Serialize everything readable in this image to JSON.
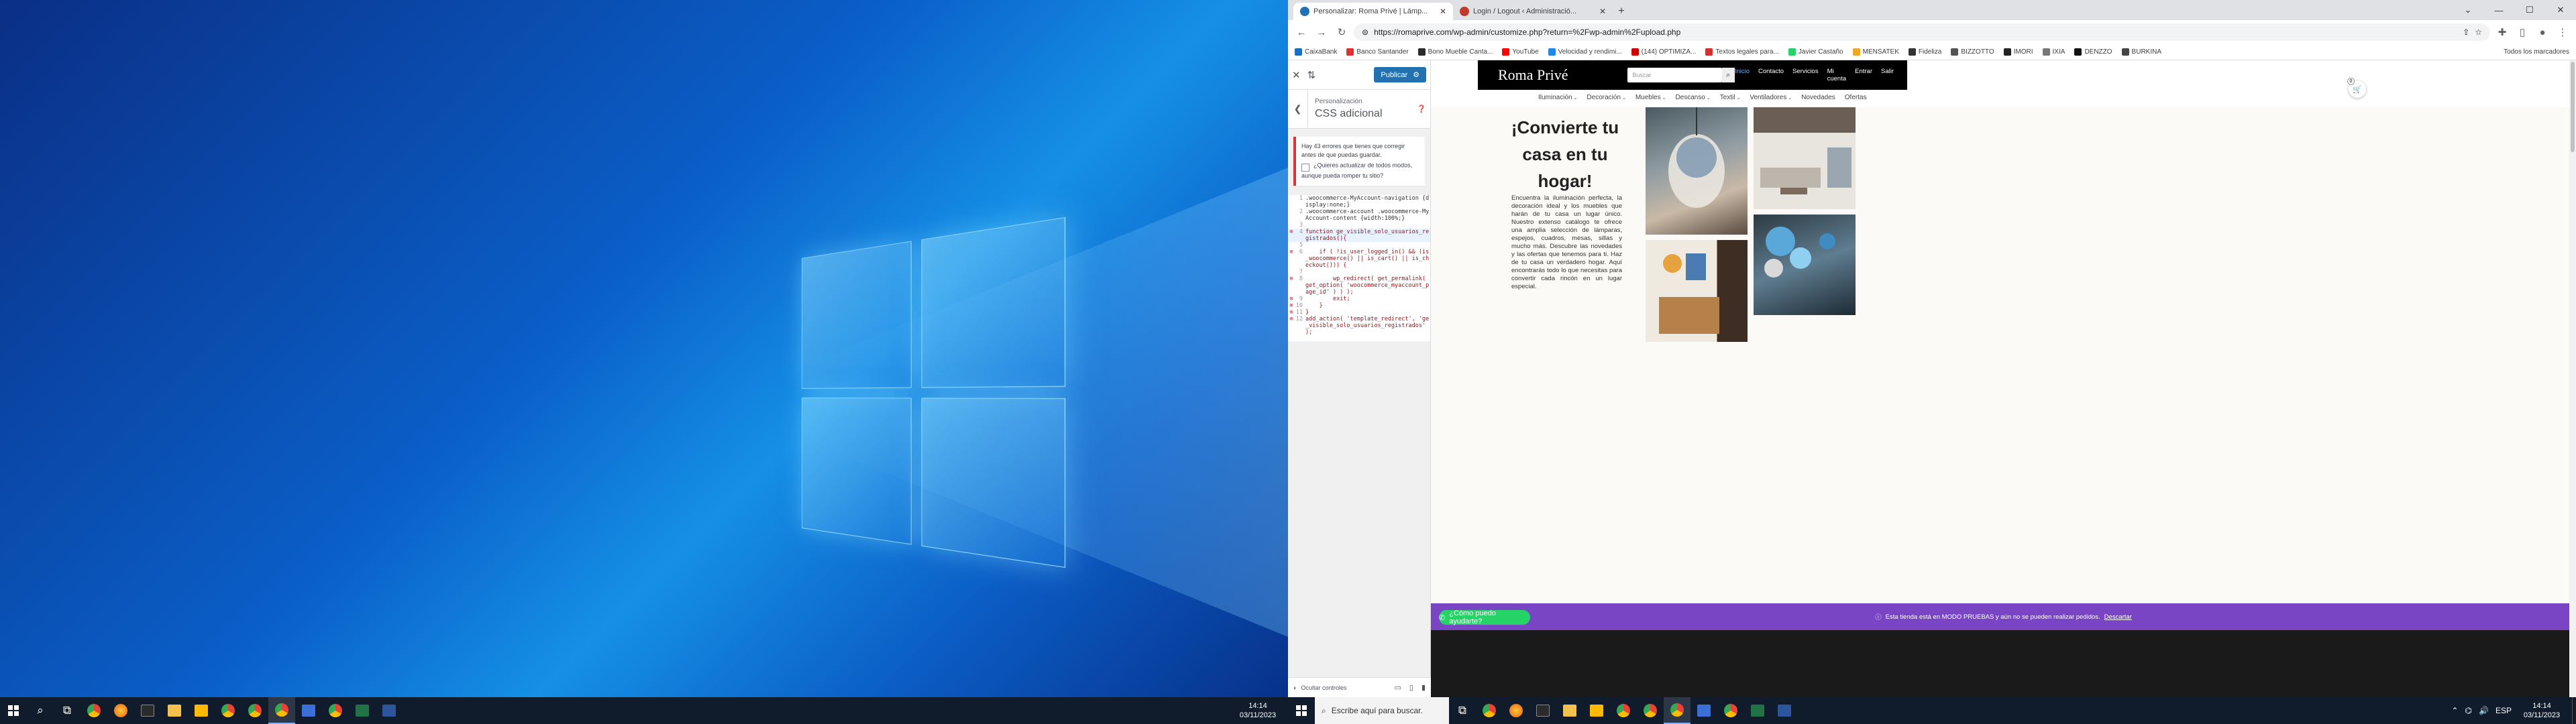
{
  "taskbar_left": {
    "time": "14:14",
    "date": "03/11/2023"
  },
  "browser": {
    "tabs": [
      {
        "label": "Personalizar: Roma Privé | Lámp...",
        "active": true,
        "color": "#2271b1"
      },
      {
        "label": "Login / Logout ‹ Administració...",
        "active": false,
        "color": "#c0392b"
      }
    ],
    "url": "https://romaprive.com/wp-admin/customize.php?return=%2Fwp-admin%2Fupload.php",
    "bookmarks": [
      "CaixaBank",
      "Banco Santander",
      "Bono Mueble Canta...",
      "YouTube",
      "Velocidad y rendimi...",
      "(144) OPTIMIZA...",
      "Textos legales para...",
      "Javier Castaño",
      "MENSATEK",
      "Fidelizа",
      "BIZZOTTO",
      "IMORI",
      "IXIA",
      "DENZZO",
      "BURKINA"
    ],
    "bookmarks_right": "Todos los marcadores"
  },
  "customizer": {
    "publish_label": "Publicar",
    "subtitle": "Personalización",
    "title": "CSS adicional",
    "notice": "Hay 43 errores que tienes que corregir antes de que puedas guardar.",
    "checkbox_label": "¿Quieres actualizar de todos modos, aunque pueda romper tu sitio?",
    "code_lines": [
      {
        "n": "1",
        "text": ".woocommerce-MyAccount-navigation {display:none;}",
        "err": false
      },
      {
        "n": "2",
        "text": ".woocommerce-account .woocommerce-MyAccount-content {width:100%;}",
        "err": false
      },
      {
        "n": "3",
        "text": "",
        "err": false
      },
      {
        "n": "4",
        "text": "function ge_visible_solo_usuarios_registrados(){",
        "err": true
      },
      {
        "n": "5",
        "text": "",
        "err": false
      },
      {
        "n": "6",
        "text": "    if ( !is_user_logged_in() && (is_woocommerce() || is_cart() || is_checkout())) {",
        "err": true
      },
      {
        "n": "7",
        "text": "",
        "err": false
      },
      {
        "n": "8",
        "text": "        wp_redirect( get_permalink( get_option( 'woocommerce_myaccount_page_id' ) ) );",
        "err": true
      },
      {
        "n": "9",
        "text": "        exit;",
        "err": true
      },
      {
        "n": "10",
        "text": "    }",
        "err": true
      },
      {
        "n": "11",
        "text": "}",
        "err": true
      },
      {
        "n": "12",
        "text": "add_action( 'template_redirect', 'ge_visible_solo_usuarios_registrados' );",
        "err": true
      }
    ],
    "footer_label": "Ocultar controles"
  },
  "site": {
    "logo": "Roma Privé",
    "search_placeholder": "Buscar",
    "nav": [
      "Inicio",
      "Contacto",
      "Servicios",
      "Mi cuenta",
      "Entrar",
      "Salir"
    ],
    "cart_count": "0",
    "menu": [
      "Iluminación",
      "Decoración",
      "Muebles",
      "Descanso",
      "Textil",
      "Ventiladores",
      "Novedades",
      "Ofertas"
    ],
    "hero_title": "¡Convierte tu casa en tu hogar!",
    "hero_text": "Encuentra la iluminación perfecta, la decoración ideal y los muebles que harán de tu casa un lugar único. Nuestro extenso catálogo te ofrece una amplia selección de lámparas, espejos, cuadros, mesas, sillas y mucho más. Descubre las novedades y las ofertas que tenemos para ti. Haz de tu casa un verdadero hogar. Aquí encontrarás todo lo que necesitas para convertir cada rincón en un lugar especial.",
    "chat_label": "¿Cómo puedo ayudarte?",
    "demo_notice": "Esta tienda está en MODO PRUEBAS y aún no se pueden realizar pedidos.",
    "demo_dismiss": "Descartar"
  },
  "taskbar_right": {
    "search_placeholder": "Escribe aquí para buscar.",
    "lang": "ESP",
    "time": "14:14",
    "date": "03/11/2023"
  }
}
